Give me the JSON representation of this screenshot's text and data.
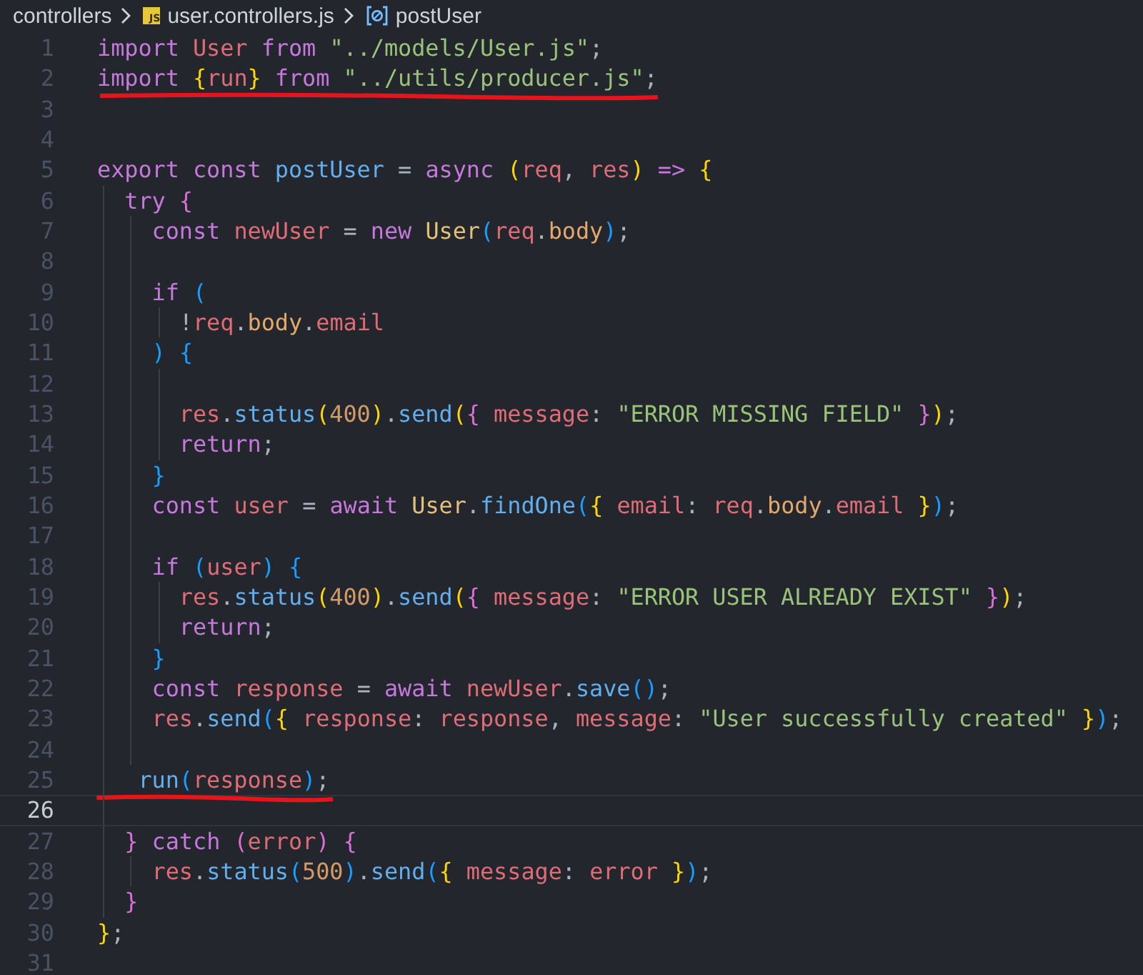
{
  "breadcrumb": [
    {
      "kind": "folder",
      "label": "controllers"
    },
    {
      "kind": "file",
      "label": "user.controllers.js",
      "badge": "JS"
    },
    {
      "kind": "symbol",
      "label": "postUser"
    }
  ],
  "lines": [
    {
      "number": "1",
      "current": false,
      "underlined": false,
      "text": "import User from \"../models/User.js\";"
    },
    {
      "number": "2",
      "current": false,
      "underlined": true,
      "text": "import {run} from \"../utils/producer.js\";"
    },
    {
      "number": "3",
      "current": false,
      "underlined": false
    },
    {
      "number": "4",
      "current": false,
      "underlined": false
    },
    {
      "number": "5",
      "current": false,
      "underlined": false,
      "text": "export const postUser = async (req, res) => {"
    },
    {
      "number": "6",
      "current": false,
      "underlined": false,
      "text": "  try {"
    },
    {
      "number": "7",
      "current": false,
      "underlined": false,
      "text": "    const newUser = new User(req.body);"
    },
    {
      "number": "8",
      "current": false,
      "underlined": false
    },
    {
      "number": "9",
      "current": false,
      "underlined": false,
      "text": "    if ("
    },
    {
      "number": "10",
      "current": false,
      "underlined": false,
      "text": "      !req.body.email"
    },
    {
      "number": "11",
      "current": false,
      "underlined": false,
      "text": "    ) {"
    },
    {
      "number": "12",
      "current": false,
      "underlined": false
    },
    {
      "number": "13",
      "current": false,
      "underlined": false,
      "text": "      res.status(400).send({ message: \"ERROR MISSING FIELD\" });"
    },
    {
      "number": "14",
      "current": false,
      "underlined": false,
      "text": "      return;"
    },
    {
      "number": "15",
      "current": false,
      "underlined": false,
      "text": "    }"
    },
    {
      "number": "16",
      "current": false,
      "underlined": false,
      "text": "    const user = await User.findOne({ email: req.body.email });"
    },
    {
      "number": "17",
      "current": false,
      "underlined": false
    },
    {
      "number": "18",
      "current": false,
      "underlined": false,
      "text": "    if (user) {"
    },
    {
      "number": "19",
      "current": false,
      "underlined": false,
      "text": "      res.status(400).send({ message: \"ERROR USER ALREADY EXIST\" });"
    },
    {
      "number": "20",
      "current": false,
      "underlined": false,
      "text": "      return;"
    },
    {
      "number": "21",
      "current": false,
      "underlined": false,
      "text": "    }"
    },
    {
      "number": "22",
      "current": false,
      "underlined": false,
      "text": "    const response = await newUser.save();"
    },
    {
      "number": "23",
      "current": false,
      "underlined": false,
      "text": "    res.send({ response: response, message: \"User successfully created\" });"
    },
    {
      "number": "24",
      "current": false,
      "underlined": false
    },
    {
      "number": "25",
      "current": false,
      "underlined": true,
      "text": "   run(response);"
    },
    {
      "number": "26",
      "current": true,
      "underlined": false
    },
    {
      "number": "27",
      "current": false,
      "underlined": false,
      "text": "  } catch (error) {"
    },
    {
      "number": "28",
      "current": false,
      "underlined": false,
      "text": "    res.status(500).send({ message: error });"
    },
    {
      "number": "29",
      "current": false,
      "underlined": false,
      "text": "  }"
    },
    {
      "number": "30",
      "current": false,
      "underlined": false,
      "text": "};"
    },
    {
      "number": "31",
      "current": false,
      "underlined": false
    }
  ]
}
